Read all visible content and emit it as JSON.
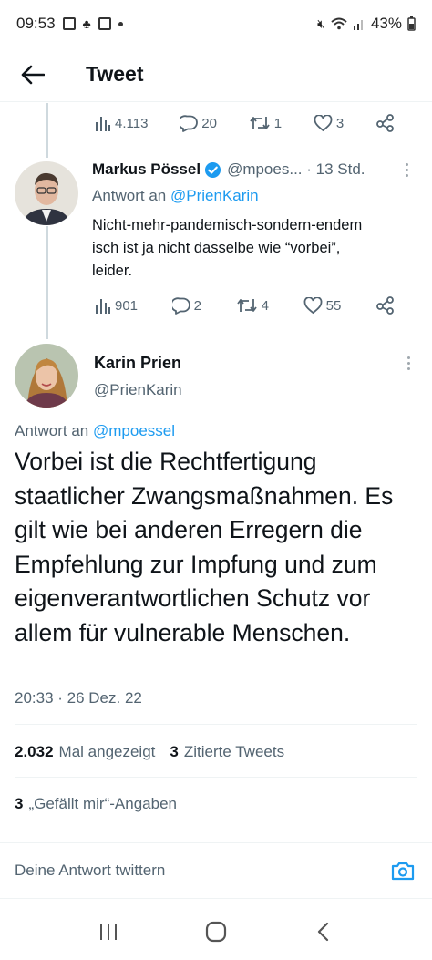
{
  "status_bar": {
    "time": "09:53",
    "battery": "43%"
  },
  "header": {
    "title": "Tweet"
  },
  "prev_actions": {
    "views": "4.113",
    "replies": "20",
    "retweets": "1",
    "likes": "3"
  },
  "tweet1": {
    "name": "Markus Pössel",
    "handle_meta": "@mpoes... · 13 Std.",
    "reply_prefix": "Antwort an",
    "reply_to": "@PrienKarin",
    "text_line1": "Nicht-mehr-pandemisch-sondern-endem",
    "text_line2": "isch ist ja nicht dasselbe wie “vorbei”,",
    "text_line3": "leider.",
    "views": "901",
    "replies": "2",
    "retweets": "4",
    "likes": "55"
  },
  "main_tweet": {
    "name": "Karin Prien",
    "handle": "@PrienKarin",
    "reply_prefix": "Antwort an",
    "reply_to": "@mpoessel",
    "text": "Vorbei ist die Rechtfertigung staatlicher Zwangsmaßnahmen. Es gilt wie bei anderen Erregern die Empfehlung zur Impfung und zum eigenverantwortlichen Schutz vor allem für vulnerable Menschen.",
    "timestamp": "20:33 · 26 Dez. 22",
    "views_count": "2.032",
    "views_label": "Mal angezeigt",
    "quotes_count": "3",
    "quotes_label": "Zitierte Tweets",
    "likes_count": "3",
    "likes_label": "„Gefällt mir“-Angaben"
  },
  "composer": {
    "placeholder": "Deine Antwort twittern"
  },
  "colors": {
    "accent": "#1d9bf0",
    "muted": "#536471",
    "text": "#0f1419",
    "divider": "#eff3f4"
  },
  "icons": [
    "back-arrow-icon",
    "views-icon",
    "reply-icon",
    "retweet-icon",
    "like-icon",
    "share-icon",
    "verified-icon",
    "more-icon",
    "camera-icon",
    "recents-icon",
    "home-icon",
    "nav-back-icon"
  ]
}
